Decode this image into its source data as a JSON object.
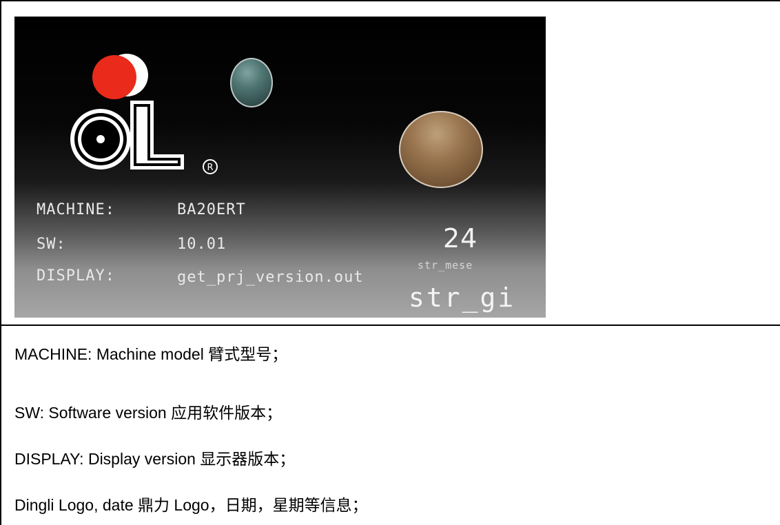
{
  "screen": {
    "machine_label": "MACHINE:",
    "machine_value": "BA20ERT",
    "sw_label": "SW:",
    "sw_value": "10.01",
    "display_label": "DISPLAY:",
    "display_value": "get_prj_version.out",
    "day_number": "24",
    "month_label": "str_mese",
    "weekday_label": "str_gi",
    "registered_mark": "®"
  },
  "descriptions": [
    "MACHINE: Machine model 臂式型号；",
    "SW: Software version 应用软件版本；",
    "DISPLAY: Display version 显示器版本；",
    "Dingli Logo, date  鼎力 Logo，日期，星期等信息；"
  ]
}
